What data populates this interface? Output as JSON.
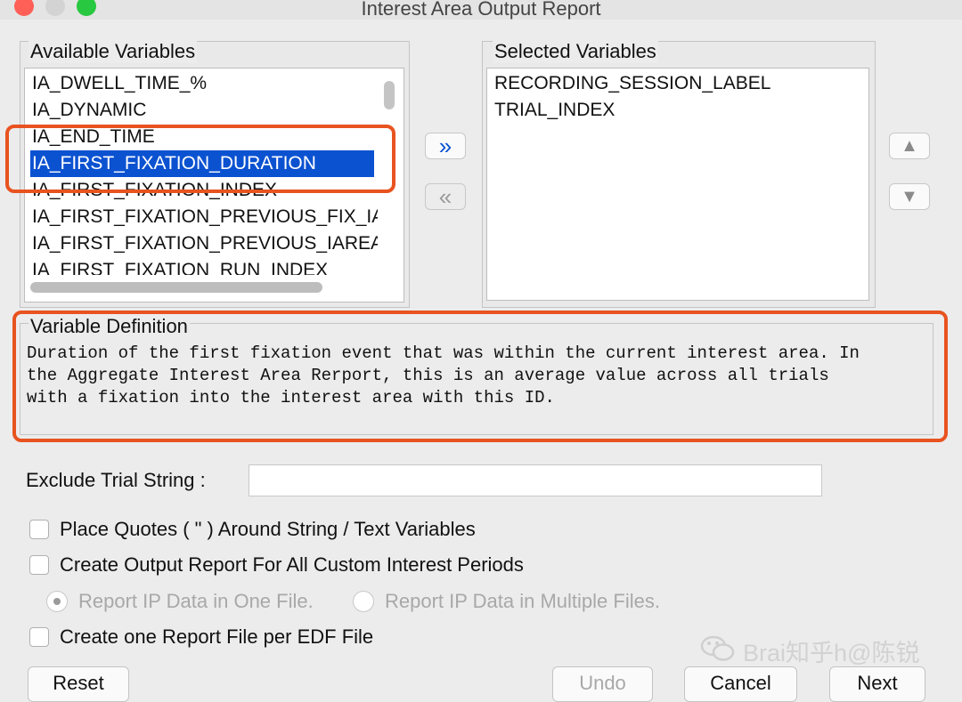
{
  "window": {
    "title": "Interest Area Output Report"
  },
  "available": {
    "legend": "Available Variables",
    "items": [
      "IA_DWELL_TIME_%",
      "IA_DYNAMIC",
      "IA_END_TIME",
      "IA_FIRST_FIXATION_DURATION",
      "IA_FIRST_FIXATION_INDEX",
      "IA_FIRST_FIXATION_PREVIOUS_FIX_IA",
      "IA_FIRST_FIXATION_PREVIOUS_IAREAS",
      "IA_FIRST_FIXATION_RUN_INDEX"
    ],
    "selected_item": "IA_FIRST_FIXATION_DURATION"
  },
  "transfer": {
    "add_glyph": "»",
    "remove_glyph": "«"
  },
  "selected": {
    "legend": "Selected Variables",
    "items": [
      "RECORDING_SESSION_LABEL",
      "TRIAL_INDEX"
    ]
  },
  "order": {
    "up_glyph": "▲",
    "down_glyph": "▼"
  },
  "definition": {
    "legend": "Variable Definition",
    "lines": [
      "Duration of the first fixation event that was within the current interest area. In",
      "the Aggregate Interest Area Rerport, this is an average value across all trials",
      "with a fixation into the interest area with this ID."
    ]
  },
  "exclude": {
    "label": "Exclude Trial String :",
    "value": ""
  },
  "options": {
    "quotes": "Place Quotes ( \" ) Around String /  Text Variables",
    "custom_periods": "Create Output Report For All Custom Interest Periods",
    "ip_one_file": "Report IP Data in One File.",
    "ip_multiple_files": "Report IP Data in Multiple Files.",
    "per_edf": "Create one Report File per EDF File"
  },
  "buttons": {
    "reset": "Reset",
    "undo": "Undo",
    "cancel": "Cancel",
    "next": "Next"
  },
  "watermark": "Brai知乎h@陈锐",
  "colors": {
    "selection": "#0b52d1",
    "highlight": "#e8531f",
    "close": "#fe5f57",
    "minimize": "#d3d3d3",
    "zoom": "#28c840"
  }
}
